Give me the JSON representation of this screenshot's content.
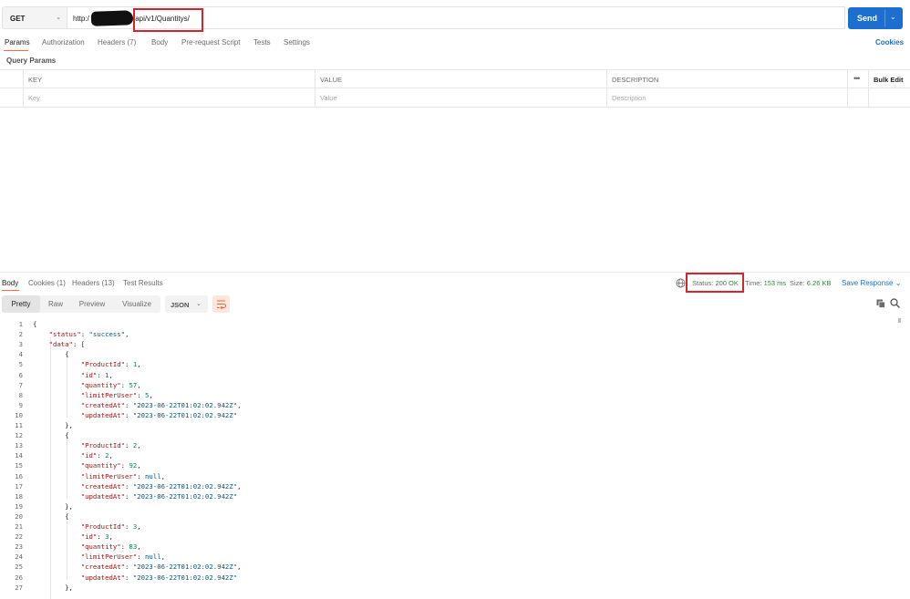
{
  "request": {
    "method": "GET",
    "url_prefix": "http:/",
    "url_suffix": "/api/v1/Quantitys/",
    "send_label": "Send"
  },
  "request_tabs": [
    {
      "label": "Params",
      "active": true
    },
    {
      "label": "Authorization"
    },
    {
      "label": "Headers (7)"
    },
    {
      "label": "Body"
    },
    {
      "label": "Pre-request Script"
    },
    {
      "label": "Tests"
    },
    {
      "label": "Settings"
    }
  ],
  "cookies_label": "Cookies",
  "query_params": {
    "title": "Query Params",
    "headers": [
      "KEY",
      "VALUE",
      "DESCRIPTION"
    ],
    "placeholders": [
      "Key",
      "Value",
      "Description"
    ],
    "more_label": "•••",
    "bulk_edit_label": "Bulk Edit"
  },
  "response_tabs": [
    {
      "label": "Body",
      "active": true
    },
    {
      "label": "Cookies (1)"
    },
    {
      "label": "Headers (13)"
    },
    {
      "label": "Test Results"
    }
  ],
  "response_meta": {
    "status_label": "Status:",
    "status_value": "200 OK",
    "time_label": "Time:",
    "time_value": "153 ms",
    "size_label": "Size:",
    "size_value": "6.26 KB",
    "save_response_label": "Save Response"
  },
  "view_modes": [
    {
      "label": "Pretty",
      "active": true
    },
    {
      "label": "Raw"
    },
    {
      "label": "Preview"
    },
    {
      "label": "Visualize"
    }
  ],
  "format_label": "JSON",
  "code_lines": [
    {
      "n": "1",
      "tokens": [
        {
          "t": "p",
          "v": "{"
        }
      ]
    },
    {
      "n": "2",
      "tokens": [
        {
          "t": "p",
          "v": "    "
        },
        {
          "t": "k",
          "v": "\"status\""
        },
        {
          "t": "p",
          "v": ": "
        },
        {
          "t": "s",
          "v": "\"success\""
        },
        {
          "t": "p",
          "v": ","
        }
      ]
    },
    {
      "n": "3",
      "tokens": [
        {
          "t": "p",
          "v": "    "
        },
        {
          "t": "k",
          "v": "\"data\""
        },
        {
          "t": "p",
          "v": ": ["
        }
      ]
    },
    {
      "n": "4",
      "tokens": [
        {
          "t": "p",
          "v": "        {"
        }
      ]
    },
    {
      "n": "5",
      "tokens": [
        {
          "t": "p",
          "v": "            "
        },
        {
          "t": "k",
          "v": "\"ProductId\""
        },
        {
          "t": "p",
          "v": ": "
        },
        {
          "t": "n",
          "v": "1"
        },
        {
          "t": "p",
          "v": ","
        }
      ]
    },
    {
      "n": "6",
      "tokens": [
        {
          "t": "p",
          "v": "            "
        },
        {
          "t": "k",
          "v": "\"id\""
        },
        {
          "t": "p",
          "v": ": "
        },
        {
          "t": "n",
          "v": "1"
        },
        {
          "t": "p",
          "v": ","
        }
      ]
    },
    {
      "n": "7",
      "tokens": [
        {
          "t": "p",
          "v": "            "
        },
        {
          "t": "k",
          "v": "\"quantity\""
        },
        {
          "t": "p",
          "v": ": "
        },
        {
          "t": "n",
          "v": "57"
        },
        {
          "t": "p",
          "v": ","
        }
      ]
    },
    {
      "n": "8",
      "tokens": [
        {
          "t": "p",
          "v": "            "
        },
        {
          "t": "k",
          "v": "\"limitPerUser\""
        },
        {
          "t": "p",
          "v": ": "
        },
        {
          "t": "n",
          "v": "5"
        },
        {
          "t": "p",
          "v": ","
        }
      ]
    },
    {
      "n": "9",
      "tokens": [
        {
          "t": "p",
          "v": "            "
        },
        {
          "t": "k",
          "v": "\"createdAt\""
        },
        {
          "t": "p",
          "v": ": "
        },
        {
          "t": "s",
          "v": "\"2023-06-22T01:02:02.942Z\""
        },
        {
          "t": "p",
          "v": ","
        }
      ]
    },
    {
      "n": "10",
      "tokens": [
        {
          "t": "p",
          "v": "            "
        },
        {
          "t": "k",
          "v": "\"updatedAt\""
        },
        {
          "t": "p",
          "v": ": "
        },
        {
          "t": "s",
          "v": "\"2023-06-22T01:02:02.942Z\""
        }
      ]
    },
    {
      "n": "11",
      "tokens": [
        {
          "t": "p",
          "v": "        },"
        }
      ]
    },
    {
      "n": "12",
      "tokens": [
        {
          "t": "p",
          "v": "        {"
        }
      ]
    },
    {
      "n": "13",
      "tokens": [
        {
          "t": "p",
          "v": "            "
        },
        {
          "t": "k",
          "v": "\"ProductId\""
        },
        {
          "t": "p",
          "v": ": "
        },
        {
          "t": "n",
          "v": "2"
        },
        {
          "t": "p",
          "v": ","
        }
      ]
    },
    {
      "n": "14",
      "tokens": [
        {
          "t": "p",
          "v": "            "
        },
        {
          "t": "k",
          "v": "\"id\""
        },
        {
          "t": "p",
          "v": ": "
        },
        {
          "t": "n",
          "v": "2"
        },
        {
          "t": "p",
          "v": ","
        }
      ]
    },
    {
      "n": "15",
      "tokens": [
        {
          "t": "p",
          "v": "            "
        },
        {
          "t": "k",
          "v": "\"quantity\""
        },
        {
          "t": "p",
          "v": ": "
        },
        {
          "t": "n",
          "v": "92"
        },
        {
          "t": "p",
          "v": ","
        }
      ]
    },
    {
      "n": "16",
      "tokens": [
        {
          "t": "p",
          "v": "            "
        },
        {
          "t": "k",
          "v": "\"limitPerUser\""
        },
        {
          "t": "p",
          "v": ": "
        },
        {
          "t": "nl",
          "v": "null"
        },
        {
          "t": "p",
          "v": ","
        }
      ]
    },
    {
      "n": "17",
      "tokens": [
        {
          "t": "p",
          "v": "            "
        },
        {
          "t": "k",
          "v": "\"createdAt\""
        },
        {
          "t": "p",
          "v": ": "
        },
        {
          "t": "s",
          "v": "\"2023-06-22T01:02:02.942Z\""
        },
        {
          "t": "p",
          "v": ","
        }
      ]
    },
    {
      "n": "18",
      "tokens": [
        {
          "t": "p",
          "v": "            "
        },
        {
          "t": "k",
          "v": "\"updatedAt\""
        },
        {
          "t": "p",
          "v": ": "
        },
        {
          "t": "s",
          "v": "\"2023-06-22T01:02:02.942Z\""
        }
      ]
    },
    {
      "n": "19",
      "tokens": [
        {
          "t": "p",
          "v": "        },"
        }
      ]
    },
    {
      "n": "20",
      "tokens": [
        {
          "t": "p",
          "v": "        {"
        }
      ]
    },
    {
      "n": "21",
      "tokens": [
        {
          "t": "p",
          "v": "            "
        },
        {
          "t": "k",
          "v": "\"ProductId\""
        },
        {
          "t": "p",
          "v": ": "
        },
        {
          "t": "n",
          "v": "3"
        },
        {
          "t": "p",
          "v": ","
        }
      ]
    },
    {
      "n": "22",
      "tokens": [
        {
          "t": "p",
          "v": "            "
        },
        {
          "t": "k",
          "v": "\"id\""
        },
        {
          "t": "p",
          "v": ": "
        },
        {
          "t": "n",
          "v": "3"
        },
        {
          "t": "p",
          "v": ","
        }
      ]
    },
    {
      "n": "23",
      "tokens": [
        {
          "t": "p",
          "v": "            "
        },
        {
          "t": "k",
          "v": "\"quantity\""
        },
        {
          "t": "p",
          "v": ": "
        },
        {
          "t": "n",
          "v": "83"
        },
        {
          "t": "p",
          "v": ","
        }
      ]
    },
    {
      "n": "24",
      "tokens": [
        {
          "t": "p",
          "v": "            "
        },
        {
          "t": "k",
          "v": "\"limitPerUser\""
        },
        {
          "t": "p",
          "v": ": "
        },
        {
          "t": "nl",
          "v": "null"
        },
        {
          "t": "p",
          "v": ","
        }
      ]
    },
    {
      "n": "25",
      "tokens": [
        {
          "t": "p",
          "v": "            "
        },
        {
          "t": "k",
          "v": "\"createdAt\""
        },
        {
          "t": "p",
          "v": ": "
        },
        {
          "t": "s",
          "v": "\"2023-06-22T01:02:02.942Z\""
        },
        {
          "t": "p",
          "v": ","
        }
      ]
    },
    {
      "n": "26",
      "tokens": [
        {
          "t": "p",
          "v": "            "
        },
        {
          "t": "k",
          "v": "\"updatedAt\""
        },
        {
          "t": "p",
          "v": ": "
        },
        {
          "t": "s",
          "v": "\"2023-06-22T01:02:02.942Z\""
        }
      ]
    },
    {
      "n": "27",
      "tokens": [
        {
          "t": "p",
          "v": "        },"
        }
      ]
    }
  ],
  "colors": {
    "send_button": "#1c6fd1",
    "active_tab_underline": "#ff6c37",
    "annotation_box": "#d6242f",
    "status_ok": "#2b8a3e"
  },
  "icons": {
    "method_dropdown": "chevron-down-icon",
    "send_dropdown": "chevron-down-icon",
    "globe": "globe-icon",
    "save_response_dropdown": "chevron-down-icon",
    "format_dropdown": "chevron-down-icon",
    "wrap": "wrap-lines-icon",
    "copy": "copy-icon",
    "search": "search-icon"
  }
}
